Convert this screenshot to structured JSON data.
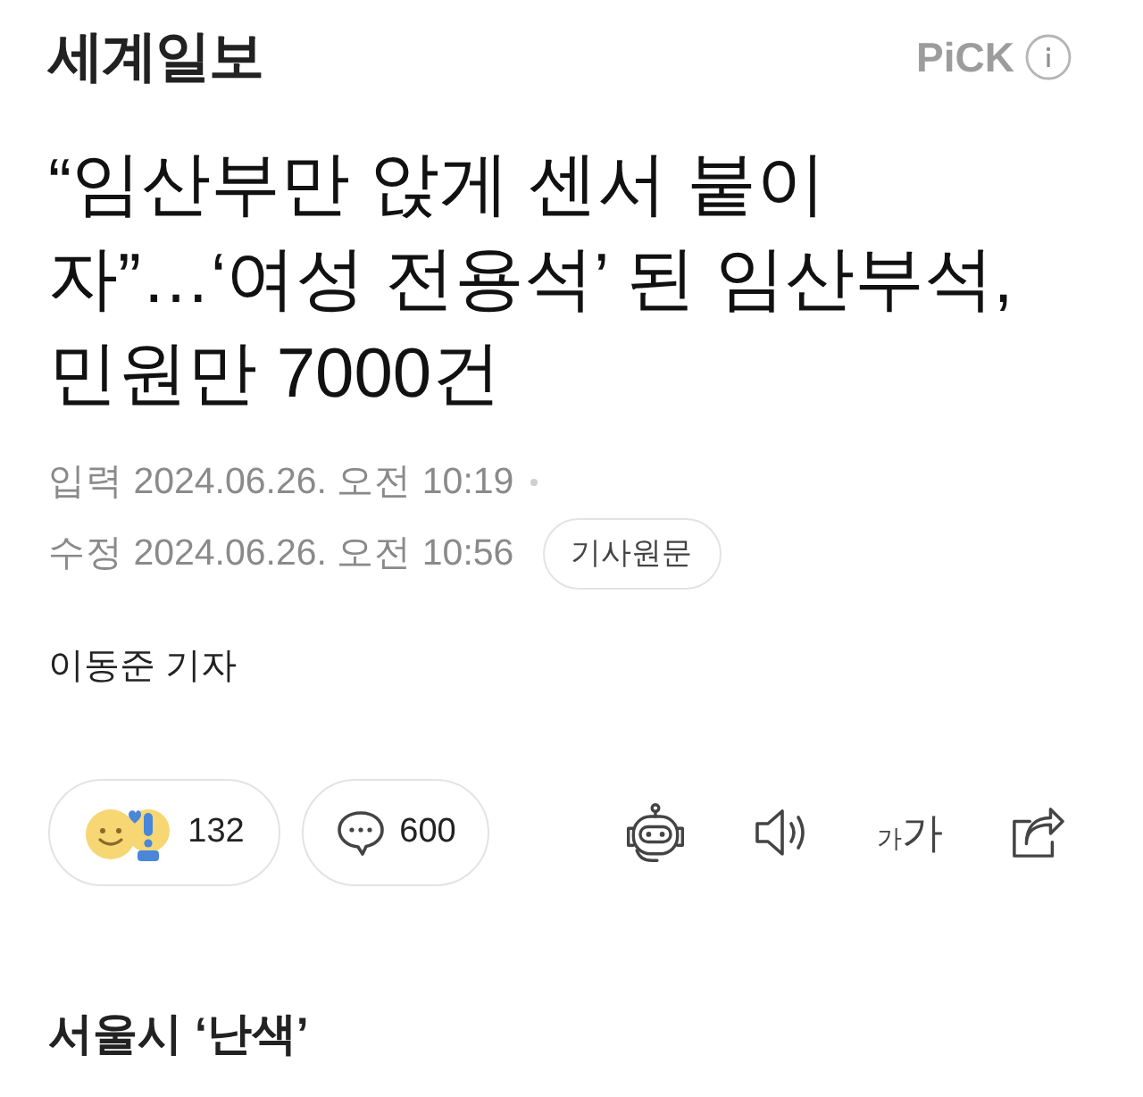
{
  "publisher": {
    "name": "세계일보",
    "badge": "PiCK"
  },
  "headline_lines": [
    "“임산부만 앉게 센서 붙이",
    "자”…‘여성 전용석’ 된 임산부석,",
    "민원만 7000건"
  ],
  "timestamps": [
    {
      "label": "입력",
      "value": "2024.06.26. 오전 10:19"
    },
    {
      "label": "수정",
      "value": "2024.06.26. 오전 10:56"
    }
  ],
  "original_link": "기사원문",
  "byline": "이동준 기자",
  "reactions": {
    "count": "132"
  },
  "comments": {
    "count": "600"
  },
  "font_size_button": {
    "small": "가",
    "large": "가"
  },
  "subheading": "서울시 ‘난색’"
}
